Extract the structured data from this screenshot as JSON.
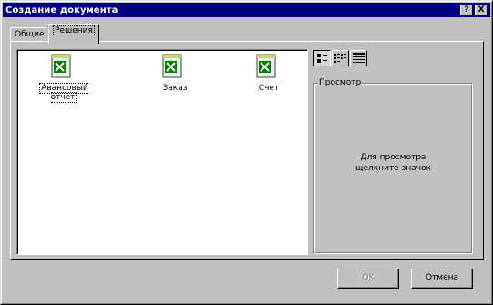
{
  "window": {
    "title": "Создание документа"
  },
  "titlebar_buttons": {
    "help": "?",
    "close": "X"
  },
  "tabs": [
    {
      "label": "Общие",
      "selected": false
    },
    {
      "label": "Решения",
      "selected": true
    }
  ],
  "documents": [
    {
      "label": "Авансовый отчет",
      "icon": "excel-template-icon",
      "selected": true
    },
    {
      "label": "Заказ",
      "icon": "excel-template-icon",
      "selected": false
    },
    {
      "label": "Счет",
      "icon": "excel-template-icon",
      "selected": false
    }
  ],
  "view_buttons": [
    {
      "icon": "large-icons-view-icon",
      "pressed": true
    },
    {
      "icon": "list-view-icon",
      "pressed": false
    },
    {
      "icon": "details-view-icon",
      "pressed": false
    }
  ],
  "preview": {
    "label": "Просмотр",
    "hint_line1": "Для просмотра",
    "hint_line2": "щелкните значок"
  },
  "buttons": {
    "ok": "OK",
    "cancel": "Отмена"
  },
  "colors": {
    "titlebar": "#000080",
    "face": "#c0c0c0",
    "excel_green": "#008000"
  }
}
